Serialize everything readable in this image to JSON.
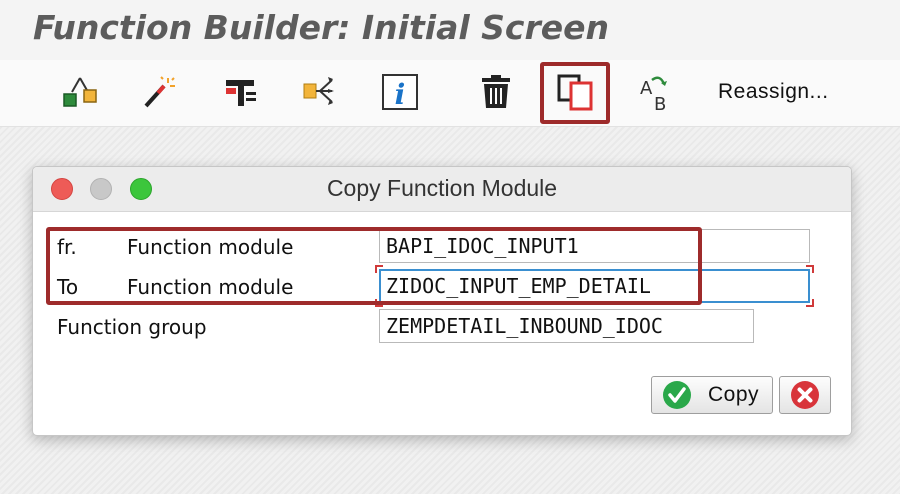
{
  "app": {
    "title": "Function Builder: Initial Screen"
  },
  "toolbar": {
    "icons": [
      "object-hierarchy-icon",
      "magic-wand-icon",
      "test-clamp-icon",
      "where-used-icon",
      "info-icon",
      "trash-icon",
      "copy-icon",
      "rename-icon"
    ],
    "rename_glyph_a": "A",
    "rename_glyph_b": "B",
    "info_glyph": "i",
    "reassign_label": "Reassign..."
  },
  "dialog": {
    "title": "Copy Function Module",
    "from_prefix": "fr.",
    "from_label": "Function module",
    "from_value": "BAPI_IDOC_INPUT1",
    "to_prefix": "To",
    "to_label": "Function module",
    "to_value": "ZIDOC_INPUT_EMP_DETAIL",
    "group_label": "Function group",
    "group_value": "ZEMPDETAIL_INBOUND_IDOC",
    "copy_label": "Copy",
    "cancel_icon": "cancel-icon"
  },
  "colors": {
    "highlight": "#9e2b2b",
    "focus_border": "#3a8fd0",
    "confirm_green": "#2aa84a",
    "cancel_red": "#d8343a"
  }
}
